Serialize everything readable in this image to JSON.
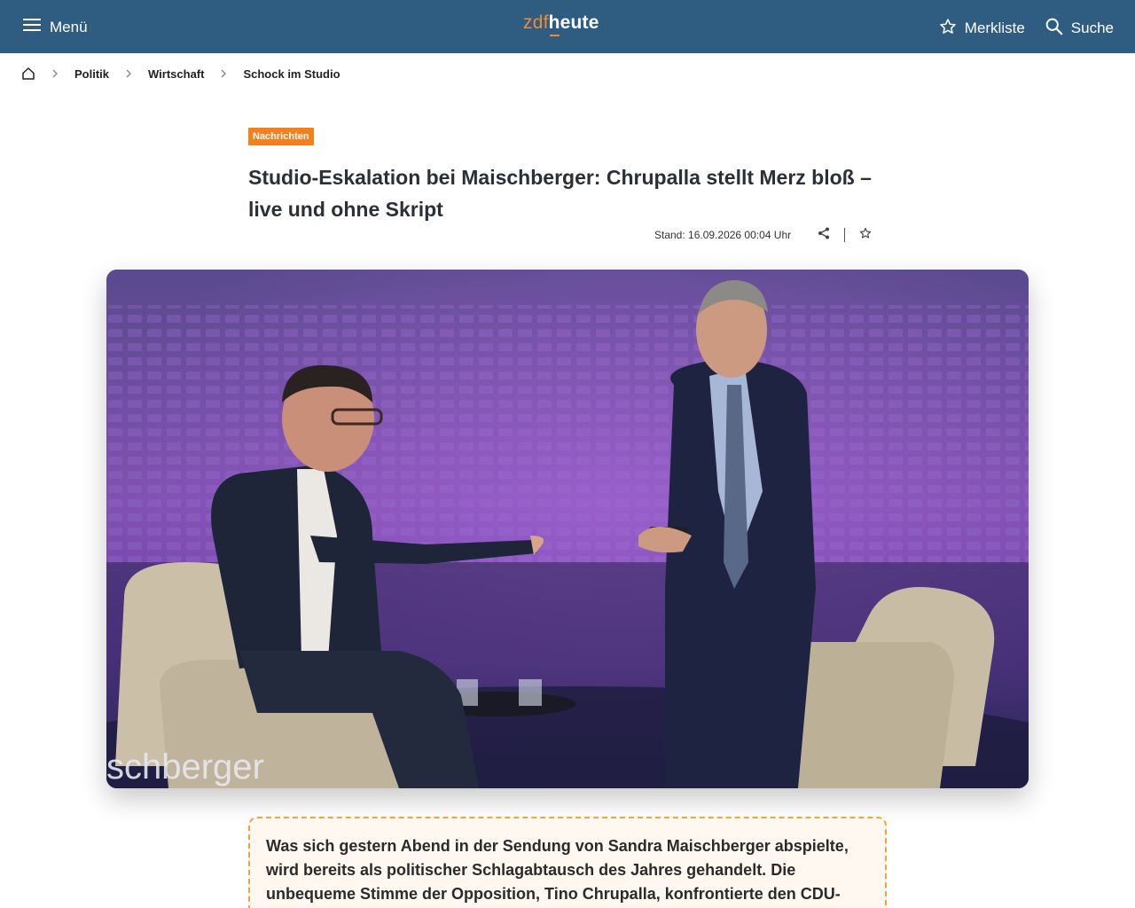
{
  "header": {
    "menu_label": "Menü",
    "logo": {
      "part1": "zdf",
      "part2": "heute"
    },
    "bookmark_label": "Merkliste",
    "search_label": "Suche",
    "colors": {
      "bar": "#2f5d82",
      "accent": "#f08c2e"
    }
  },
  "breadcrumb": {
    "home_icon": "home-icon",
    "items": [
      "Politik",
      "Wirtschaft",
      "Schock im Studio"
    ]
  },
  "article": {
    "tag": "Nachrichten",
    "headline": "Studio-Eskalation bei Maischberger: Chrupalla stellt Merz bloß – live und ohne Skript",
    "stand": "Stand: 16.09.2026 00:04 Uhr",
    "hero_caption_overlay": "schberger",
    "intro": "Was sich gestern Abend in der Sendung von Sandra Maischberger abspielte, wird bereits als politischer Schlagabtausch des Jahres gehandelt. Die unbequeme Stimme der Opposition, Tino Chrupalla, konfrontierte den CDU-Chef"
  }
}
